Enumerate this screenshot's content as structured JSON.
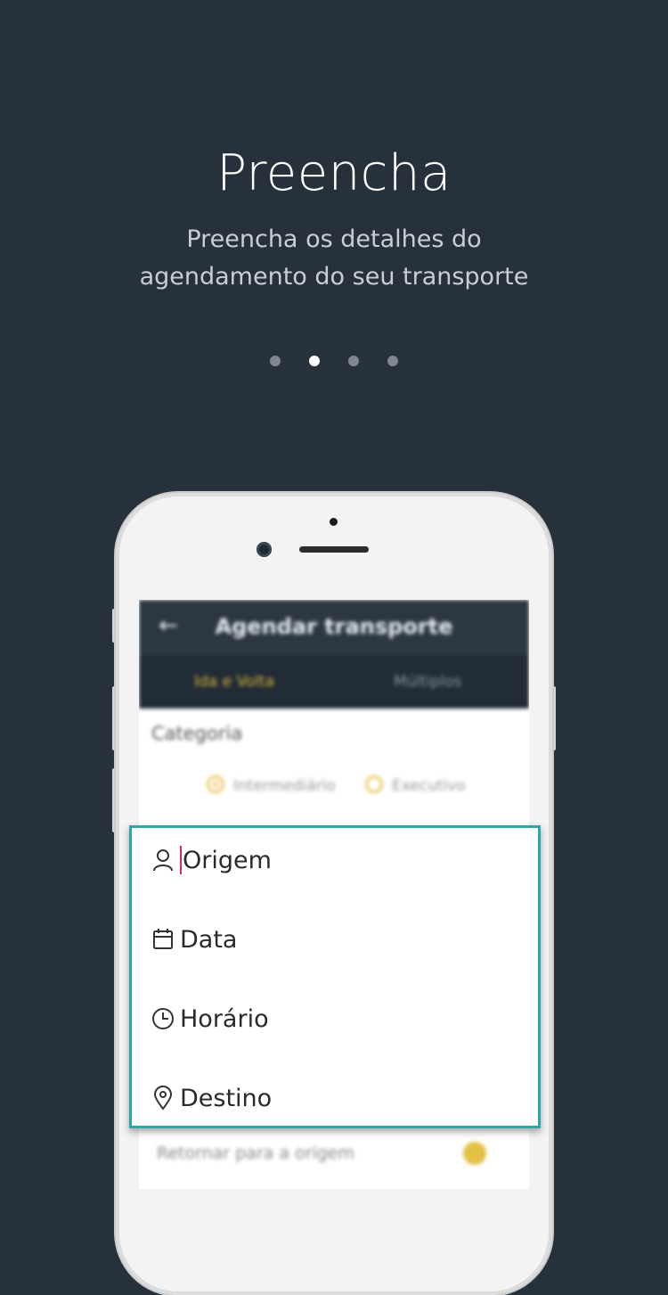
{
  "header": {
    "title": "Preencha",
    "subtitle_line1": "Preencha os detalhes do",
    "subtitle_line2": "agendamento do seu transporte"
  },
  "pagination": {
    "total": 4,
    "active_index": 1
  },
  "phone_screen": {
    "app_title": "Agendar transporte",
    "tabs": [
      "Ida e Volta",
      "Múltiplos"
    ],
    "category_label": "Categoria",
    "category_options": [
      {
        "label": "Intermediário",
        "selected": true
      },
      {
        "label": "Executivo",
        "selected": false
      }
    ],
    "return_label": "Retornar para a origem"
  },
  "form": {
    "fields": [
      {
        "label": "Origem",
        "icon": "person-icon"
      },
      {
        "label": "Data",
        "icon": "calendar-icon"
      },
      {
        "label": "Horário",
        "icon": "clock-icon"
      },
      {
        "label": "Destino",
        "icon": "location-pin-icon"
      }
    ]
  },
  "colors": {
    "background": "#26313c",
    "highlight_border": "#2fa6a6",
    "accent": "#d6b13a",
    "caret": "#d6286a"
  }
}
